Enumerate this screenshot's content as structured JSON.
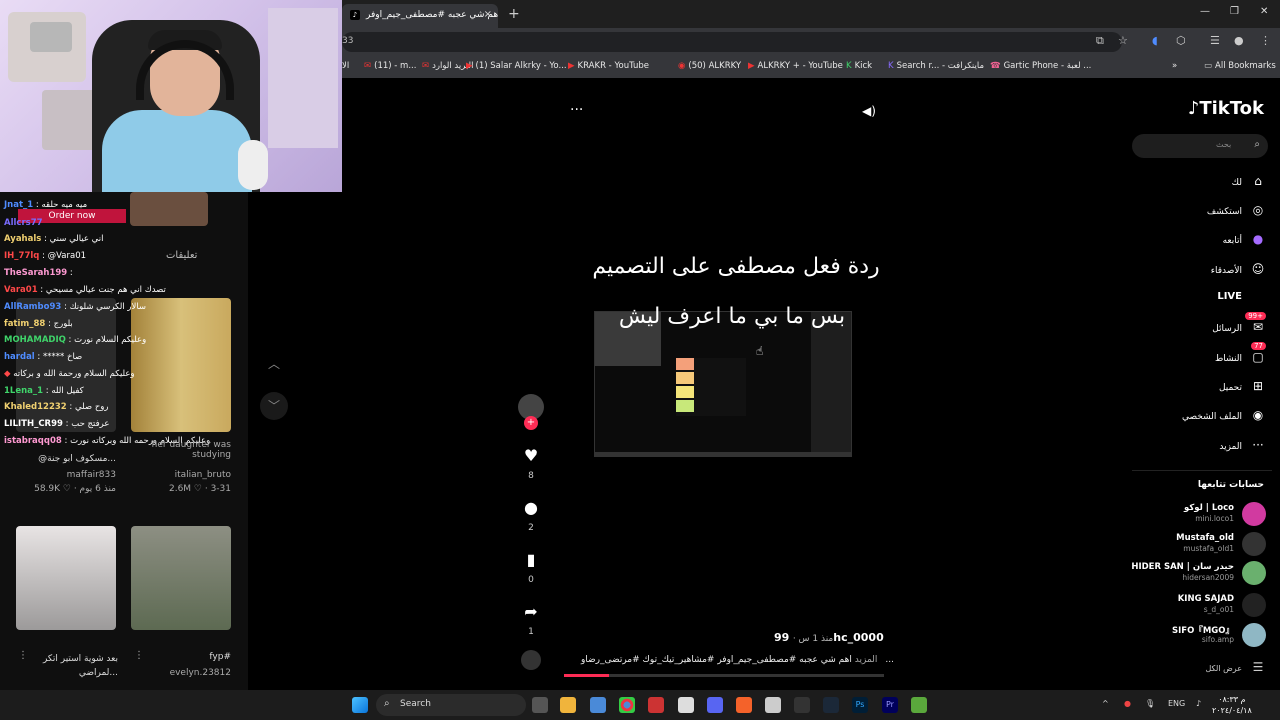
{
  "browser": {
    "tab_title": "اهم شي عجبه #مصطفى_جيم_اوفر",
    "tab_close": "×",
    "new_tab": "+",
    "address_fragment": "33",
    "win_min": "—",
    "win_max": "❐",
    "win_close": "✕",
    "bookmarks": [
      "الا",
      "(11) - m...",
      "البريد الوارد",
      "(1) Salar Alkrky - Yo...",
      "KRAKR - YouTube",
      "(50) ALKRKY",
      "ALKRKY + - YouTube",
      "Kick",
      "Search r... - ماينكرافت",
      "Gartic Phone - لعبة ...",
      "»",
      "All Bookmarks"
    ]
  },
  "stream_chat": [
    {
      "user": "Jnat_1",
      "msg": "ميه ميه حلقه",
      "color": "#4f8cff"
    },
    {
      "user": "Allcrs77",
      "msg": "",
      "color": "#7a6cff"
    },
    {
      "user": "Ayahals",
      "msg": "اني عيالي سني",
      "color": "#f0d070"
    },
    {
      "user": "IH_77lq",
      "msg": "@Vara01",
      "color": "#ff4848"
    },
    {
      "user": "TheSarah199",
      "msg": "",
      "color": "#ff9ad2"
    },
    {
      "user": "Vara01",
      "msg": "تصدك اني هم جنت عيالي مسيحي",
      "color": "#ff4848"
    },
    {
      "user": "AllRambo93",
      "msg": "سالار الكرسي شلونك",
      "color": "#4f8cff"
    },
    {
      "user": "fatim_88",
      "msg": "بلورج",
      "color": "#f0d070"
    },
    {
      "user": "MOHAMADIQ",
      "msg": "وعليكم السلام نورت",
      "color": "#3fd46a"
    },
    {
      "user": "hardal",
      "msg": "***** صاخ",
      "color": "#4f8cff"
    },
    {
      "user": "",
      "msg": "وعليكم السلام ورحمة الله و بركاته",
      "color": "#ff4848"
    },
    {
      "user": "1Lena_1",
      "msg": "كفيل الله",
      "color": "#3fd46a"
    },
    {
      "user": "Khaled12232",
      "msg": "روح صلي",
      "color": "#f0d070"
    },
    {
      "user": "LILITH_CR99",
      "msg": "عرفتج حب",
      "color": "#ffffff"
    },
    {
      "user": "istabraqq08",
      "msg": "وعليكم السلام ورحمه الله وبركاته نورت",
      "color": "#ff9ad2"
    }
  ],
  "order_now": "Order now",
  "comments_label": "تعليقات",
  "tiles": [
    {
      "title": "@مسكوف ابو جنة...",
      "user": "maffair833",
      "meta": "58.9K ♡ · منذ 6 يوم"
    },
    {
      "title": "her daughter was studying",
      "user": "italian_bruto",
      "meta": "2.6M ♡ · 3-31"
    },
    {
      "title": "بعد شوية استير اتكر لمراضي...",
      "user": "",
      "meta": ""
    },
    {
      "title": "fyp#",
      "user": "evelyn.23812",
      "meta": ""
    }
  ],
  "video": {
    "more": "···",
    "title": "ردة فعل مصطفى على التصميم",
    "subtitle": "بس ما بي ما اعرف ليش",
    "likes": "8",
    "comments": "2",
    "saves": "0",
    "shares": "1",
    "author": "99hc_0000",
    "time": "منذ 1 س ·",
    "description": "اهم شي عجبه #مصطفى_جيم_اوفر #مشاهير_تيك_توك #مرتضى_رضاو...",
    "more_label": "المزيد",
    "progress_fraction": 0.14
  },
  "tiktok": {
    "logo": "TikTok",
    "search_placeholder": "بحث",
    "nav": [
      {
        "label": "لك",
        "icon": "⌂"
      },
      {
        "label": "استكشف",
        "icon": "◎"
      },
      {
        "label": "أتابعه",
        "icon": "●"
      },
      {
        "label": "الأصدقاء",
        "icon": "☺"
      },
      {
        "label": "LIVE",
        "icon": ""
      },
      {
        "label": "الرسائل",
        "icon": "✉",
        "badge": "99+"
      },
      {
        "label": "النشاط",
        "icon": "▢",
        "badge": "77"
      },
      {
        "label": "تحميل",
        "icon": "⊞"
      },
      {
        "label": "الملف الشخصي",
        "icon": "◉"
      },
      {
        "label": "المزيد",
        "icon": "···"
      }
    ],
    "following_header": "حسابات تتابعها",
    "following": [
      {
        "name": "لوكو | Loco",
        "handle": "mini.loco1"
      },
      {
        "name": "Mustafa_old",
        "handle": "mustafa_old1"
      },
      {
        "name": "HIDER SAN | حيدر سان",
        "handle": "hidersan2009"
      },
      {
        "name": "KING SAJAD",
        "handle": "s_d_o01"
      },
      {
        "name": "SIFO『MGO』",
        "handle": "sifo.amp"
      }
    ],
    "see_all": "عرض الكل"
  },
  "taskbar": {
    "search": "Search",
    "lang": "ENG",
    "time": "م ٠٨:٣٣",
    "date": "٢٠٢٤/٠٤/١٨"
  }
}
